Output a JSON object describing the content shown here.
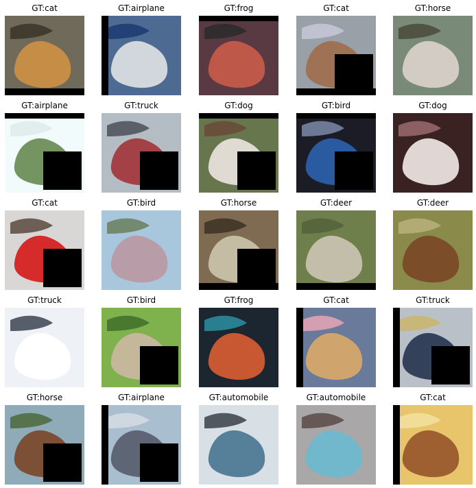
{
  "grid": {
    "cells": [
      {
        "label": "GT:cat",
        "scene": {
          "bg": "#6f6a5a",
          "blob": "#c98f45",
          "accent": "#3a3428"
        },
        "erase": false,
        "pad": "bottom"
      },
      {
        "label": "GT:airplane",
        "scene": {
          "bg": "#4d6a93",
          "blob": "#d9dde0",
          "accent": "#1d3a72"
        },
        "erase": false,
        "pad": "left"
      },
      {
        "label": "GT:frog",
        "scene": {
          "bg": "#5a3a42",
          "blob": "#c45a4a",
          "accent": "#2a2a2a"
        },
        "erase": false,
        "pad": "top"
      },
      {
        "label": "GT:cat",
        "scene": {
          "bg": "#9aa0a8",
          "blob": "#a07050",
          "accent": "#c8c8d8"
        },
        "erase": true,
        "pad": "bottom"
      },
      {
        "label": "GT:horse",
        "scene": {
          "bg": "#7a8a78",
          "blob": "#d8d0c8",
          "accent": "#4a4a3a"
        },
        "erase": false,
        "pad": "none"
      },
      {
        "label": "GT:airplane",
        "scene": {
          "bg": "#f1fbfb",
          "blob": "#6d8f5a",
          "accent": "#dfeaea"
        },
        "erase": true,
        "pad": "top"
      },
      {
        "label": "GT:truck",
        "scene": {
          "bg": "#b4bcc4",
          "blob": "#a33a40",
          "accent": "#4a4f58"
        },
        "erase": true,
        "pad": "none"
      },
      {
        "label": "GT:dog",
        "scene": {
          "bg": "#68764d",
          "blob": "#e6e0da",
          "accent": "#6a4a3a"
        },
        "erase": true,
        "pad": "top"
      },
      {
        "label": "GT:bird",
        "scene": {
          "bg": "#1b1c26",
          "blob": "#2b5fa6",
          "accent": "#7a88a8"
        },
        "erase": true,
        "pad": "top"
      },
      {
        "label": "GT:dog",
        "scene": {
          "bg": "#3a2222",
          "blob": "#e9e1de",
          "accent": "#9b6b6f"
        },
        "erase": false,
        "pad": "none"
      },
      {
        "label": "GT:cat",
        "scene": {
          "bg": "#d9d7d6",
          "blob": "#d52322",
          "accent": "#5b4a3f"
        },
        "erase": true,
        "pad": "none"
      },
      {
        "label": "GT:bird",
        "scene": {
          "bg": "#a8c6dc",
          "blob": "#b89aa3",
          "accent": "#6b7f5d"
        },
        "erase": false,
        "pad": "none"
      },
      {
        "label": "GT:horse",
        "scene": {
          "bg": "#7e6b52",
          "blob": "#c8c1a8",
          "accent": "#3c3124"
        },
        "erase": true,
        "pad": "bottom"
      },
      {
        "label": "GT:deer",
        "scene": {
          "bg": "#6f7f4b",
          "blob": "#c7c2ae",
          "accent": "#55613b"
        },
        "erase": false,
        "pad": "bottom"
      },
      {
        "label": "GT:deer",
        "scene": {
          "bg": "#8a8a4a",
          "blob": "#7a4a26",
          "accent": "#b8b07a"
        },
        "erase": false,
        "pad": "none"
      },
      {
        "label": "GT:truck",
        "scene": {
          "bg": "#eef2f6",
          "blob": "#ffffff",
          "accent": "#3b4454"
        },
        "erase": false,
        "pad": "none"
      },
      {
        "label": "GT:bird",
        "scene": {
          "bg": "#7fb14d",
          "blob": "#c9b79d",
          "accent": "#3f6f2a"
        },
        "erase": true,
        "pad": "none"
      },
      {
        "label": "GT:frog",
        "scene": {
          "bg": "#1b2630",
          "blob": "#d25b32",
          "accent": "#2b8ea0"
        },
        "erase": false,
        "pad": "none"
      },
      {
        "label": "GT:cat",
        "scene": {
          "bg": "#6a7a9a",
          "blob": "#d6a86a",
          "accent": "#e7a6b6"
        },
        "erase": false,
        "pad": "left"
      },
      {
        "label": "GT:truck",
        "scene": {
          "bg": "#bac0c8",
          "blob": "#2b3a55",
          "accent": "#c9b66b"
        },
        "erase": true,
        "pad": "left"
      },
      {
        "label": "GT:horse",
        "scene": {
          "bg": "#8faab8",
          "blob": "#7a4b2e",
          "accent": "#4e6a3a"
        },
        "erase": true,
        "pad": "none"
      },
      {
        "label": "GT:airplane",
        "scene": {
          "bg": "#a9bfcf",
          "blob": "#5a6070",
          "accent": "#d6dce4"
        },
        "erase": true,
        "pad": "left"
      },
      {
        "label": "GT:automobile",
        "scene": {
          "bg": "#d8e0e6",
          "blob": "#4f7a96",
          "accent": "#3a3f48"
        },
        "erase": false,
        "pad": "none"
      },
      {
        "label": "GT:automobile",
        "scene": {
          "bg": "#a9a7a8",
          "blob": "#6fb8cf",
          "accent": "#5a4a46"
        },
        "erase": false,
        "pad": "none"
      },
      {
        "label": "GT:cat",
        "scene": {
          "bg": "#e8c46a",
          "blob": "#9a5a2e",
          "accent": "#f2e0a0"
        },
        "erase": false,
        "pad": "left"
      }
    ]
  }
}
